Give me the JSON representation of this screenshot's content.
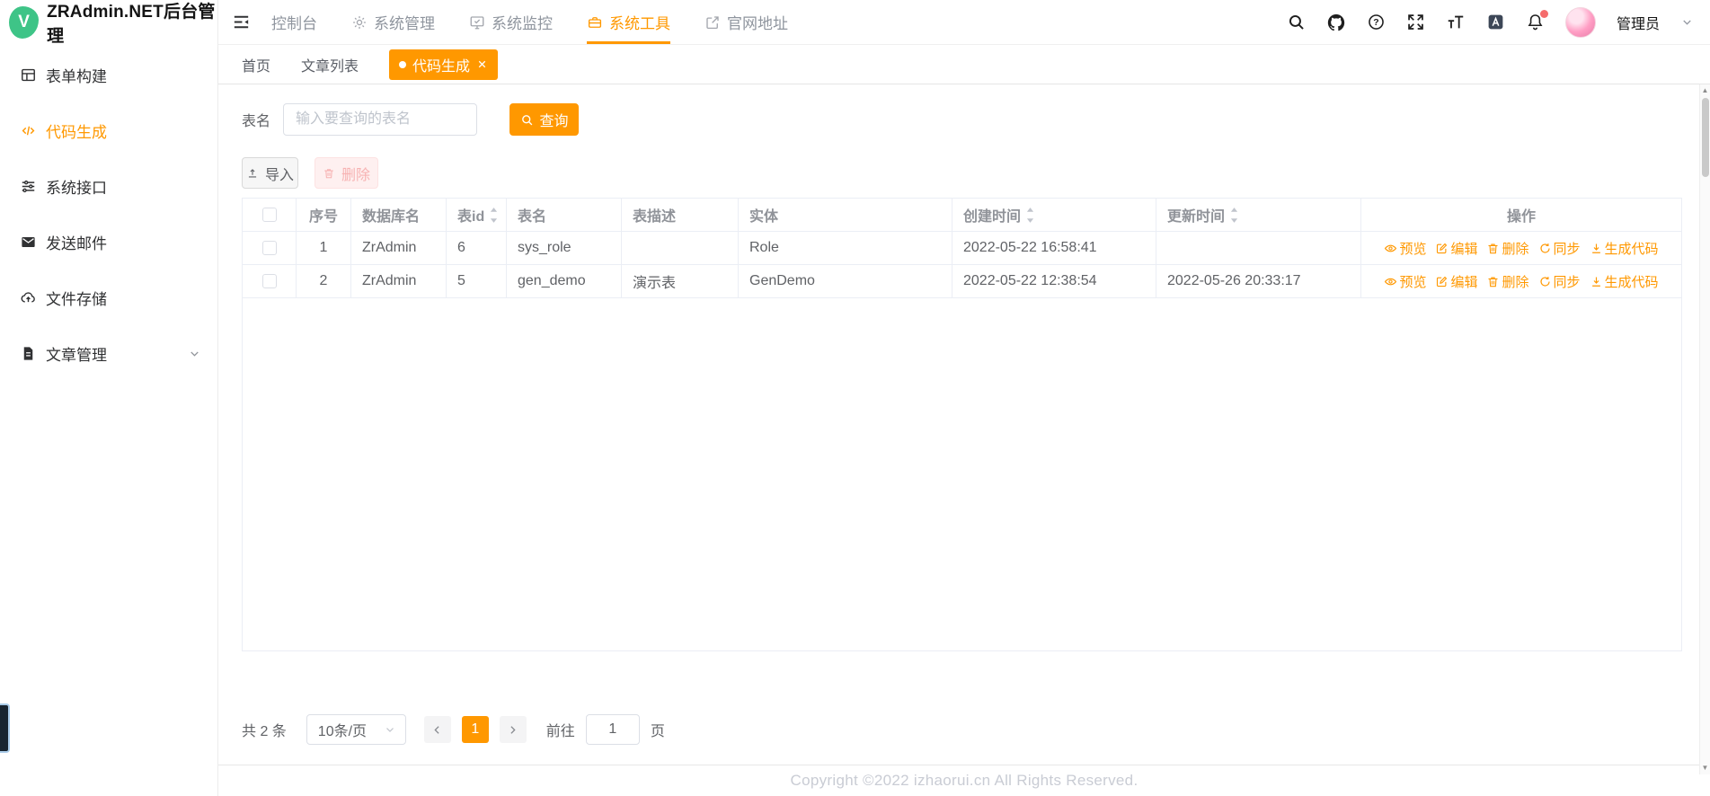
{
  "colors": {
    "accent": "#ff9800",
    "danger": "#f56c6c",
    "logo_green": "#3ec487"
  },
  "brand": {
    "logo_letter": "V",
    "title": "ZRAdmin.NET后台管理"
  },
  "sidebar": {
    "items": [
      {
        "label": "表单构建",
        "icon": "form-grid-icon"
      },
      {
        "label": "代码生成",
        "icon": "code-icon",
        "active": true
      },
      {
        "label": "系统接口",
        "icon": "sliders-icon"
      },
      {
        "label": "发送邮件",
        "icon": "mail-icon"
      },
      {
        "label": "文件存储",
        "icon": "cloud-upload-icon"
      },
      {
        "label": "文章管理",
        "icon": "document-icon",
        "expandable": true
      }
    ]
  },
  "topnav": {
    "items": [
      {
        "label": "控制台"
      },
      {
        "label": "系统管理",
        "icon": "gear-icon"
      },
      {
        "label": "系统监控",
        "icon": "monitor-icon"
      },
      {
        "label": "系统工具",
        "icon": "toolbox-icon",
        "active": true
      },
      {
        "label": "官网地址",
        "icon": "external-link-icon"
      }
    ],
    "user_label": "管理员"
  },
  "tabs": [
    {
      "label": "首页"
    },
    {
      "label": "文章列表"
    },
    {
      "label": "代码生成",
      "active": true,
      "closable": true
    }
  ],
  "search": {
    "label": "表名",
    "placeholder": "输入要查询的表名",
    "query_label": "查询"
  },
  "toolbar": {
    "import_label": "导入",
    "delete_label": "删除"
  },
  "table": {
    "headers": [
      "序号",
      "数据库名",
      "表id",
      "表名",
      "表描述",
      "实体",
      "创建时间",
      "更新时间",
      "操作"
    ],
    "ops": [
      "预览",
      "编辑",
      "删除",
      "同步",
      "生成代码"
    ],
    "rows": [
      {
        "seq": "1",
        "db": "ZrAdmin",
        "table_id": "6",
        "name": "sys_role",
        "desc": "",
        "entity": "Role",
        "created": "2022-05-22 16:58:41",
        "updated": ""
      },
      {
        "seq": "2",
        "db": "ZrAdmin",
        "table_id": "5",
        "name": "gen_demo",
        "desc": "演示表",
        "entity": "GenDemo",
        "created": "2022-05-22 12:38:54",
        "updated": "2022-05-26 20:33:17"
      }
    ]
  },
  "pagination": {
    "total_label": "共 2 条",
    "page_size": "10条/页",
    "current": "1",
    "goto_label": "前往",
    "goto_value": "1",
    "unit_label": "页"
  },
  "footer": {
    "copyright": "Copyright ©2022 izhaorui.cn All Rights Reserved."
  }
}
